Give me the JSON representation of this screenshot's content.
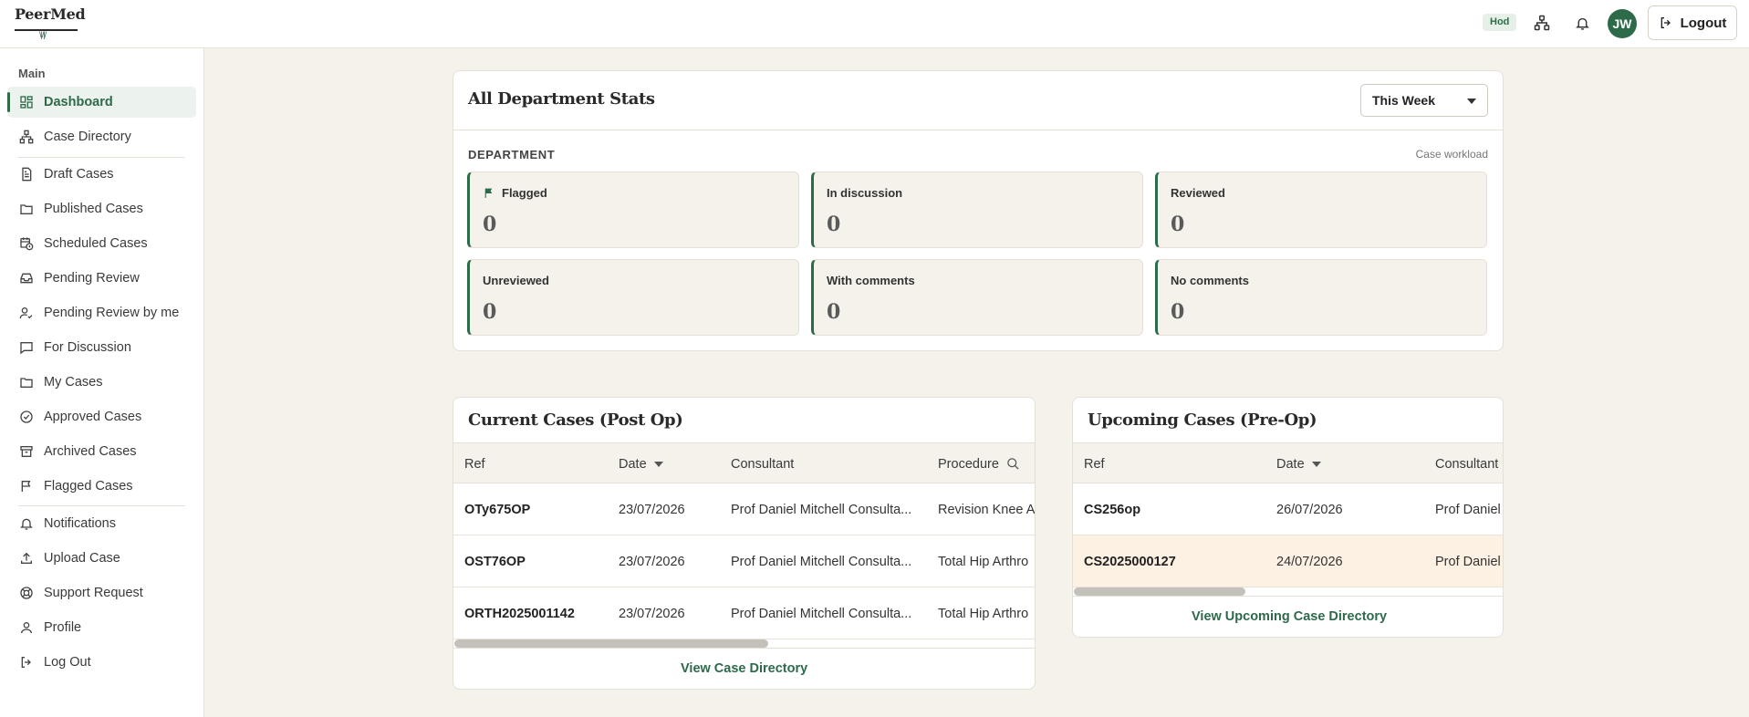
{
  "app": {
    "logo_text": "PeerMed",
    "logo_mark": "\\|/|/"
  },
  "topbar": {
    "role_badge": "Hod",
    "avatar_initials": "JW",
    "logout_label": "Logout"
  },
  "sidebar": {
    "section_label": "Main",
    "items": [
      {
        "label": "Dashboard",
        "icon": "grid-icon",
        "active": true
      },
      {
        "label": "Case Directory",
        "icon": "network-icon"
      },
      {
        "label": "Draft Cases",
        "icon": "document-icon"
      },
      {
        "label": "Published Cases",
        "icon": "folder-icon"
      },
      {
        "label": "Scheduled Cases",
        "icon": "calendar-clock-icon"
      },
      {
        "label": "Pending Review",
        "icon": "inbox-icon"
      },
      {
        "label": "Pending Review by me",
        "icon": "user-check-icon"
      },
      {
        "label": "For Discussion",
        "icon": "chat-icon"
      },
      {
        "label": "My Cases",
        "icon": "folder-icon"
      },
      {
        "label": "Approved Cases",
        "icon": "check-circle-icon"
      },
      {
        "label": "Archived Cases",
        "icon": "archive-icon"
      },
      {
        "label": "Flagged Cases",
        "icon": "flag-icon"
      },
      {
        "label": "Notifications",
        "icon": "bell-icon"
      },
      {
        "label": "Upload Case",
        "icon": "upload-icon"
      },
      {
        "label": "Support Request",
        "icon": "lifebuoy-icon"
      },
      {
        "label": "Profile",
        "icon": "user-icon"
      },
      {
        "label": "Log Out",
        "icon": "logout-icon"
      }
    ]
  },
  "stats": {
    "title": "All Department Stats",
    "period_selected": "This Week",
    "section_label": "DEPARTMENT",
    "section_note": "Case workload",
    "boxes": [
      {
        "label": "Flagged",
        "value": "0"
      },
      {
        "label": "In discussion",
        "value": "0"
      },
      {
        "label": "Reviewed",
        "value": "0"
      },
      {
        "label": "Unreviewed",
        "value": "0"
      },
      {
        "label": "With comments",
        "value": "0"
      },
      {
        "label": "No comments",
        "value": "0"
      }
    ]
  },
  "current_cases": {
    "title": "Current Cases (Post Op)",
    "columns": [
      "Ref",
      "Date",
      "Consultant",
      "Procedure"
    ],
    "rows": [
      {
        "ref": "OTy675OP",
        "date": "23/07/2026",
        "consultant": "Prof Daniel Mitchell Consulta...",
        "procedure": "Revision Knee A"
      },
      {
        "ref": "OST76OP",
        "date": "23/07/2026",
        "consultant": "Prof Daniel Mitchell Consulta...",
        "procedure": "Total Hip Arthro"
      },
      {
        "ref": "ORTH2025001142",
        "date": "23/07/2026",
        "consultant": "Prof Daniel Mitchell Consulta...",
        "procedure": "Total Hip Arthro"
      }
    ],
    "link_label": "View Case Directory"
  },
  "upcoming_cases": {
    "title": "Upcoming Cases (Pre-Op)",
    "columns": [
      "Ref",
      "Date",
      "Consultant"
    ],
    "rows": [
      {
        "ref": "CS256op",
        "date": "26/07/2026",
        "consultant": "Prof Daniel"
      },
      {
        "ref": "CS2025000127",
        "date": "24/07/2026",
        "consultant": "Prof Daniel",
        "highlighted": true
      }
    ],
    "link_label": "View Upcoming Case Directory"
  },
  "colors": {
    "accent": "#2d6a4a",
    "page_bg": "#f5f2ec",
    "highlight_row": "#fcf1e2"
  }
}
